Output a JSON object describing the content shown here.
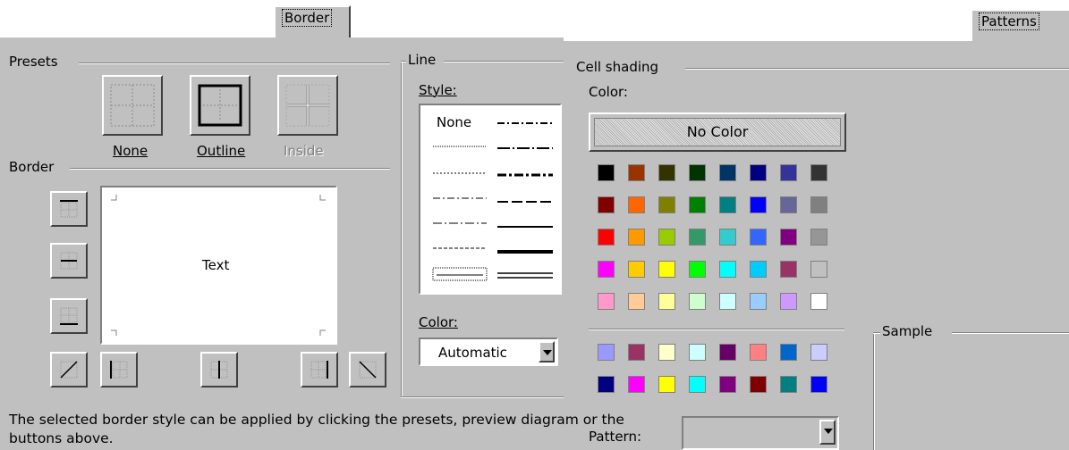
{
  "tabs": {
    "border": "Border",
    "patterns": "Patterns"
  },
  "border_panel": {
    "presets_label": "Presets",
    "presets": [
      {
        "label": "None",
        "enabled": true
      },
      {
        "label": "Outline",
        "enabled": true
      },
      {
        "label": "Inside",
        "enabled": false
      }
    ],
    "border_label": "Border",
    "preview_text": "Text",
    "hint": "The selected border style can be applied by clicking the presets, preview diagram or the buttons above."
  },
  "line_panel": {
    "group_label": "Line",
    "style_label": "Style:",
    "style_none": "None",
    "color_label": "Color:",
    "color_value": "Automatic"
  },
  "patterns_panel": {
    "cell_shading_label": "Cell shading",
    "color_label": "Color:",
    "no_color_label": "No Color",
    "pattern_label": "Pattern:",
    "sample_label": "Sample",
    "palette": [
      [
        "#000000",
        "#993300",
        "#333300",
        "#003300",
        "#003366",
        "#000080",
        "#333399",
        "#333333"
      ],
      [
        "#800000",
        "#ff6600",
        "#808000",
        "#008000",
        "#008080",
        "#0000ff",
        "#666699",
        "#808080"
      ],
      [
        "#ff0000",
        "#ff9900",
        "#99cc00",
        "#339966",
        "#33cccc",
        "#3366ff",
        "#800080",
        "#969696"
      ],
      [
        "#ff00ff",
        "#ffcc00",
        "#ffff00",
        "#00ff00",
        "#00ffff",
        "#00ccff",
        "#993366",
        "#c0c0c0"
      ],
      [
        "#ff99cc",
        "#ffcc99",
        "#ffff99",
        "#ccffcc",
        "#ccffff",
        "#99ccff",
        "#cc99ff",
        "#ffffff"
      ]
    ],
    "chart_palette": [
      [
        "#9999ff",
        "#993366",
        "#ffffcc",
        "#ccffff",
        "#660066",
        "#ff8080",
        "#0066cc",
        "#ccccff"
      ],
      [
        "#000080",
        "#ff00ff",
        "#ffff00",
        "#00ffff",
        "#800080",
        "#800000",
        "#008080",
        "#0000ff"
      ]
    ]
  }
}
